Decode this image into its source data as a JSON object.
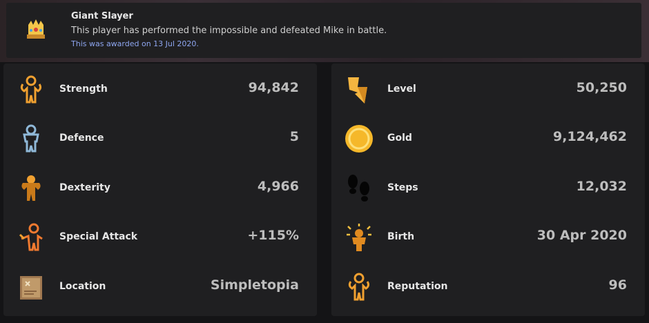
{
  "award": {
    "icon": "crown-icon",
    "title": "Giant Slayer",
    "description": "This player has performed the impossible and defeated Mike in battle.",
    "date_text": "This was awarded on 13 Jul 2020."
  },
  "left_stats": [
    {
      "icon": "strength-figure-icon",
      "label": "Strength",
      "value": "94,842"
    },
    {
      "icon": "defence-figure-icon",
      "label": "Defence",
      "value": "5"
    },
    {
      "icon": "dexterity-figure-icon",
      "label": "Dexterity",
      "value": "4,966"
    },
    {
      "icon": "special-attack-figure-icon",
      "label": "Special Attack",
      "value": "+115%"
    },
    {
      "icon": "map-scroll-icon",
      "label": "Location",
      "value": "Simpletopia"
    }
  ],
  "right_stats": [
    {
      "icon": "lightning-bolt-icon",
      "label": "Level",
      "value": "50,250"
    },
    {
      "icon": "gold-coin-icon",
      "label": "Gold",
      "value": "9,124,462"
    },
    {
      "icon": "footprints-icon",
      "label": "Steps",
      "value": "12,032"
    },
    {
      "icon": "birth-sparkle-icon",
      "label": "Birth",
      "value": "30 Apr 2020"
    },
    {
      "icon": "reputation-figure-icon",
      "label": "Reputation",
      "value": "96"
    }
  ],
  "colors": {
    "panel": "#1f1f21",
    "background": "#141416",
    "label": "#e6e6e6",
    "value": "#bdbdbd",
    "date_link": "#8ea6f0",
    "icon_orange": "#f0a030"
  }
}
